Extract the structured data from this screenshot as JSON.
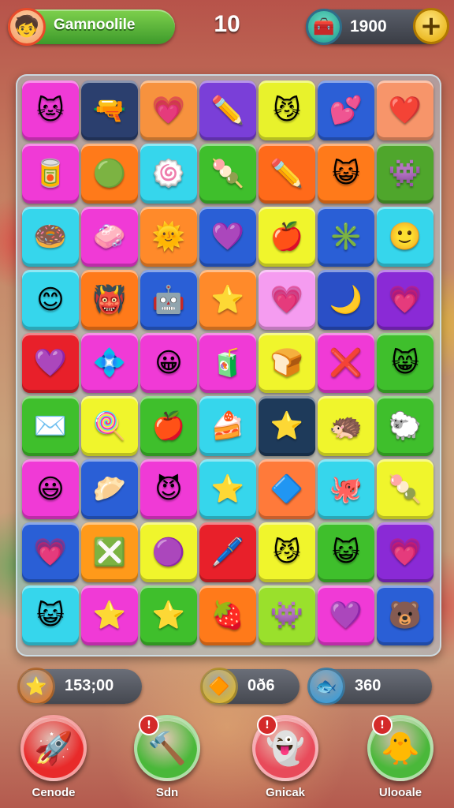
{
  "header": {
    "profile_name": "Gamnoolile",
    "avatar_icon": "kid-face-icon",
    "level": "10",
    "coins": "1900",
    "coins_icon": "treasure-box-icon",
    "add_icon": "plus-icon"
  },
  "board": {
    "columns": 7,
    "rows": 9,
    "tiles": [
      {
        "color": "#f03ad6",
        "glyph": "🐱"
      },
      {
        "color": "#2b3f6e",
        "glyph": "🔫"
      },
      {
        "color": "#f7923e",
        "glyph": "💗"
      },
      {
        "color": "#7a3fd8",
        "glyph": "✏️"
      },
      {
        "color": "#e8f22c",
        "glyph": "😼"
      },
      {
        "color": "#2c5fd6",
        "glyph": "💕"
      },
      {
        "color": "#f7956a",
        "glyph": "❤️"
      },
      {
        "color": "#f03ad6",
        "glyph": "🥫"
      },
      {
        "color": "#ff7a1a",
        "glyph": "🟢"
      },
      {
        "color": "#36d6ec",
        "glyph": "🍥"
      },
      {
        "color": "#3fbf2c",
        "glyph": "🍡"
      },
      {
        "color": "#ff6a1a",
        "glyph": "✏️"
      },
      {
        "color": "#ff7a1a",
        "glyph": "😺"
      },
      {
        "color": "#4fa62c",
        "glyph": "👾"
      },
      {
        "color": "#36d6ec",
        "glyph": "🍩"
      },
      {
        "color": "#f03ad6",
        "glyph": "🧼"
      },
      {
        "color": "#ff8a2a",
        "glyph": "🌞"
      },
      {
        "color": "#2a5fd6",
        "glyph": "💜"
      },
      {
        "color": "#f0f52c",
        "glyph": "🍎"
      },
      {
        "color": "#2a5fd6",
        "glyph": "✳️"
      },
      {
        "color": "#36d6ec",
        "glyph": "🙂"
      },
      {
        "color": "#36d6ec",
        "glyph": "😊"
      },
      {
        "color": "#ff7a1a",
        "glyph": "👹"
      },
      {
        "color": "#2a5fd6",
        "glyph": "🤖"
      },
      {
        "color": "#ff8a2a",
        "glyph": "⭐"
      },
      {
        "color": "#f59cf0",
        "glyph": "💗"
      },
      {
        "color": "#2a4fc6",
        "glyph": "🌙"
      },
      {
        "color": "#8a2ad6",
        "glyph": "💗"
      },
      {
        "color": "#e8202a",
        "glyph": "💜"
      },
      {
        "color": "#f03ad6",
        "glyph": "💠"
      },
      {
        "color": "#f03ad6",
        "glyph": "😀"
      },
      {
        "color": "#f03ad6",
        "glyph": "🧃"
      },
      {
        "color": "#f0f52c",
        "glyph": "🍞"
      },
      {
        "color": "#f03ad6",
        "glyph": "❌"
      },
      {
        "color": "#3fbf2c",
        "glyph": "😸"
      },
      {
        "color": "#3fbf2c",
        "glyph": "✉️"
      },
      {
        "color": "#f0f52c",
        "glyph": "🍭"
      },
      {
        "color": "#3fbf2c",
        "glyph": "🍎"
      },
      {
        "color": "#36d6ec",
        "glyph": "🍰"
      },
      {
        "color": "#1e3a5a",
        "glyph": "⭐"
      },
      {
        "color": "#f0f52c",
        "glyph": "🦔"
      },
      {
        "color": "#3fbf2c",
        "glyph": "🐑"
      },
      {
        "color": "#f03ad6",
        "glyph": "😃"
      },
      {
        "color": "#2a5fd6",
        "glyph": "🥟"
      },
      {
        "color": "#f03ad6",
        "glyph": "😈"
      },
      {
        "color": "#36d6ec",
        "glyph": "⭐"
      },
      {
        "color": "#ff7a3a",
        "glyph": "🔷"
      },
      {
        "color": "#36d6ec",
        "glyph": "🐙"
      },
      {
        "color": "#f0f52c",
        "glyph": "🍡"
      },
      {
        "color": "#2a5fd6",
        "glyph": "💗"
      },
      {
        "color": "#ff9a1a",
        "glyph": "❎"
      },
      {
        "color": "#f0f52c",
        "glyph": "🟣"
      },
      {
        "color": "#e8202a",
        "glyph": "🖊️"
      },
      {
        "color": "#f0f52c",
        "glyph": "😼"
      },
      {
        "color": "#3fbf2c",
        "glyph": "😺"
      },
      {
        "color": "#8a2ad6",
        "glyph": "💗"
      },
      {
        "color": "#36d6ec",
        "glyph": "😺"
      },
      {
        "color": "#f03ad6",
        "glyph": "⭐"
      },
      {
        "color": "#3fbf2c",
        "glyph": "⭐"
      },
      {
        "color": "#ff7a1a",
        "glyph": "🍓"
      },
      {
        "color": "#9ae02c",
        "glyph": "👾"
      },
      {
        "color": "#f03ad6",
        "glyph": "💜"
      },
      {
        "color": "#2a5fd6",
        "glyph": "🐻"
      }
    ]
  },
  "stats": [
    {
      "value": "153;00",
      "icon": "star-medal-icon",
      "icon_color": "#f07a1a"
    },
    {
      "value": "0ð6",
      "icon": "gem-coin-icon",
      "icon_color": "#f2c21a"
    },
    {
      "value": "360",
      "icon": "blue-fish-icon",
      "icon_color": "#2aa0e8"
    }
  ],
  "actions": [
    {
      "label": "Cenode",
      "icon": "rocket-duck-icon",
      "color": "#e82a2a"
    },
    {
      "label": "Sdn",
      "icon": "hammer-duck-icon",
      "color": "#4ab83a"
    },
    {
      "label": "Gnicak",
      "icon": "blob-ghost-icon",
      "color": "#e84a5a"
    },
    {
      "label": "Ulooale",
      "icon": "yellow-duck-icon",
      "color": "#4ab83a"
    }
  ]
}
